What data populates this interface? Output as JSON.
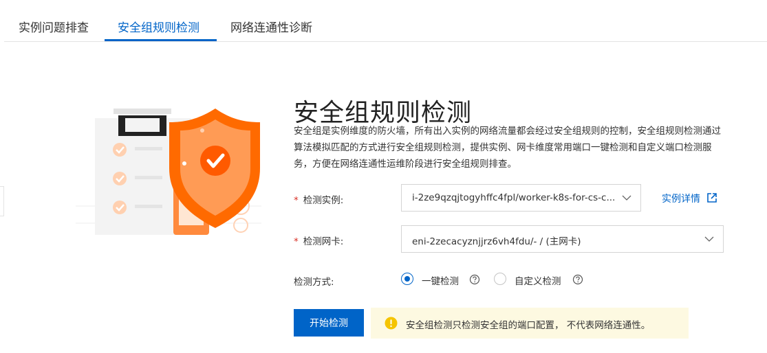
{
  "tabs": [
    {
      "label": "实例问题排查",
      "active": false
    },
    {
      "label": "安全组规则检测",
      "active": true
    },
    {
      "label": "网络连通性诊断",
      "active": false
    }
  ],
  "page": {
    "title": "安全组规则检测",
    "description": "安全组是实例维度的防火墙，所有出入实例的网络流量都会经过安全组规则的控制，安全组规则检测通过算法模拟匹配的方式进行安全组规则检测，提供实例、网卡维度常用端口一键检测和自定义端口检测服务，方便在网络连通性运维阶段进行安全组规则排查。"
  },
  "form": {
    "required_mark": "*",
    "instance": {
      "label": "检测实例:",
      "value": "i-2ze9qzqjtogyhffc4fpl/worker-k8s-for-cs-c..."
    },
    "instance_detail_link": "实例详情",
    "nic": {
      "label": "检测网卡:",
      "value": "eni-2zecacyznjjrz6vh4fdu/- / (主网卡)"
    },
    "method": {
      "label": "检测方式:",
      "options": [
        {
          "label": "一键检测",
          "selected": true
        },
        {
          "label": "自定义检测",
          "selected": false
        }
      ]
    },
    "start_button": "开始检测"
  },
  "notice": {
    "text": "安全组检测只检测安全组的端口配置， 不代表网络连通性。"
  },
  "colors": {
    "primary": "#0064c8",
    "warning_bg": "#fdf9e1",
    "warning_icon": "#f5c400",
    "shield_orange": "#ff6a00",
    "required": "#d93026"
  },
  "icons": {
    "external": "external-link-icon",
    "help": "question-circle-icon",
    "warning": "warning-circle-icon",
    "dropdown": "chevron-down-icon"
  }
}
